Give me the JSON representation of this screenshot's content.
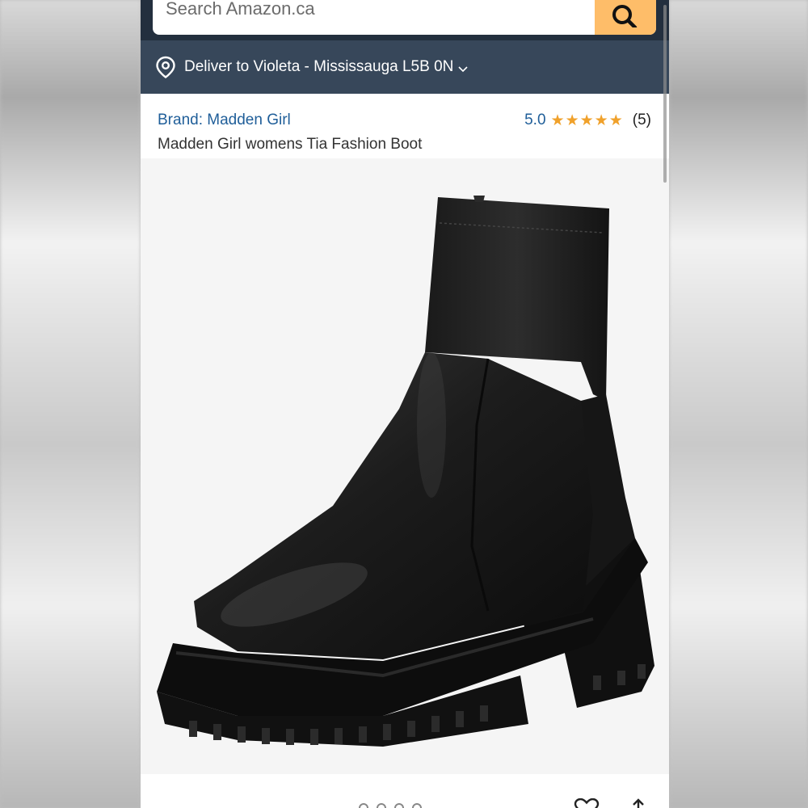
{
  "search": {
    "placeholder": "Search Amazon.ca"
  },
  "icons": {
    "search": "search-icon",
    "location": "location-pin-icon",
    "chevron": "chevron-down-icon",
    "star": "star-icon",
    "heart": "heart-icon",
    "share": "share-icon"
  },
  "delivery": {
    "text": "Deliver to Violeta - Mississauga L5B 0N"
  },
  "product": {
    "brand": "Brand: Madden Girl",
    "title": "Madden Girl womens Tia Fashion Boot",
    "rating": "5.0",
    "stars": 5,
    "review_count": "(5)",
    "image": "black-ankle-boot-image"
  },
  "colors": {
    "header_bg": "#232f3e",
    "deliver_bg": "#37475a",
    "search_button": "#febd69",
    "link": "#1f5e99",
    "star": "#f0a12b"
  }
}
